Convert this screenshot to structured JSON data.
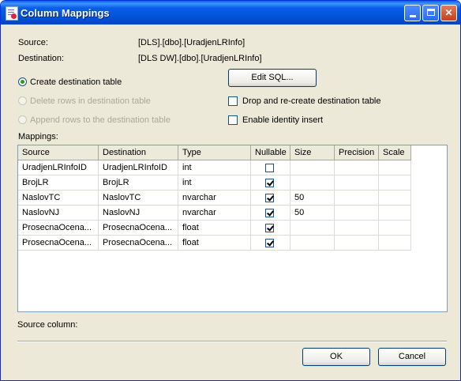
{
  "window": {
    "title": "Column Mappings"
  },
  "info": {
    "source_label": "Source:",
    "source_value": "[DLS].[dbo].[UradjenLRInfo]",
    "destination_label": "Destination:",
    "destination_value": "[DLS DW].[dbo].[UradjenLRInfo]"
  },
  "options": {
    "create_dest": "Create destination table",
    "delete_rows": "Delete rows in destination table",
    "append_rows": "Append rows to the destination table",
    "edit_sql": "Edit SQL...",
    "drop_recreate": "Drop and re-create destination table",
    "identity_insert": "Enable identity insert"
  },
  "mappings": {
    "label": "Mappings:",
    "columns": [
      "Source",
      "Destination",
      "Type",
      "Nullable",
      "Size",
      "Precision",
      "Scale"
    ],
    "rows": [
      {
        "source": "UradjenLRInfoID",
        "destination": "UradjenLRInfoID",
        "type": "int",
        "nullable": false,
        "size": "",
        "precision": "",
        "scale": ""
      },
      {
        "source": "BrojLR",
        "destination": "BrojLR",
        "type": "int",
        "nullable": true,
        "size": "",
        "precision": "",
        "scale": ""
      },
      {
        "source": "NaslovTC",
        "destination": "NaslovTC",
        "type": "nvarchar",
        "nullable": true,
        "size": "50",
        "precision": "",
        "scale": ""
      },
      {
        "source": "NaslovNJ",
        "destination": "NaslovNJ",
        "type": "nvarchar",
        "nullable": true,
        "size": "50",
        "precision": "",
        "scale": ""
      },
      {
        "source": "ProsecnaOcena...",
        "destination": "ProsecnaOcena...",
        "type": "float",
        "nullable": true,
        "size": "",
        "precision": "",
        "scale": ""
      },
      {
        "source": "ProsecnaOcena...",
        "destination": "ProsecnaOcena...",
        "type": "float",
        "nullable": true,
        "size": "",
        "precision": "",
        "scale": ""
      }
    ]
  },
  "footer": {
    "source_column_label": "Source column:",
    "ok": "OK",
    "cancel": "Cancel"
  }
}
